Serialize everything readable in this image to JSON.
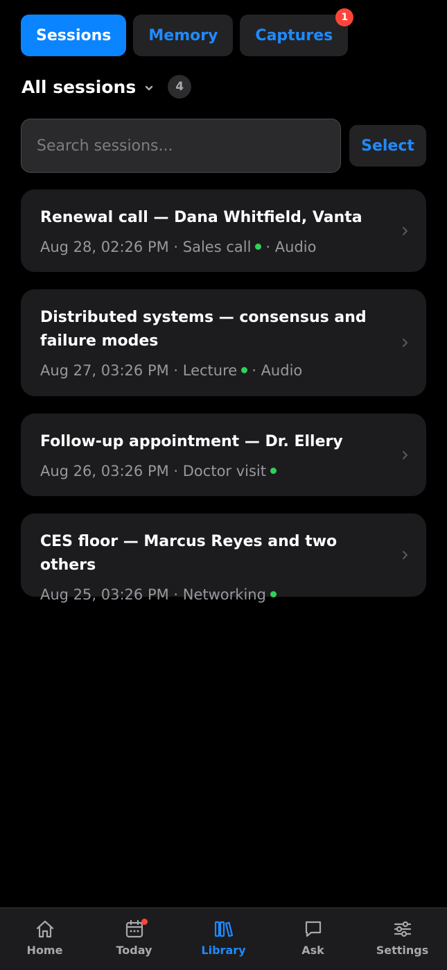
{
  "tabs": [
    {
      "label": "Sessions",
      "active": true
    },
    {
      "label": "Memory",
      "active": false
    },
    {
      "label": "Captures",
      "active": false,
      "badge": "1"
    }
  ],
  "filter": {
    "title": "All sessions",
    "count": "4"
  },
  "search": {
    "placeholder": "Search sessions..."
  },
  "select_label": "Select",
  "sessions": [
    {
      "title": "Renewal call — Dana Whitfield, Vanta",
      "date": "Aug 28, 02:26 PM",
      "type": "Sales call",
      "source": "Audio"
    },
    {
      "title": "Distributed systems — consensus and failure modes",
      "date": "Aug 27, 03:26 PM",
      "type": "Lecture",
      "source": "Audio"
    },
    {
      "title": "Follow-up appointment — Dr. Ellery",
      "date": "Aug 26, 03:26 PM",
      "type": "Doctor visit",
      "source": ""
    },
    {
      "title": "CES floor — Marcus Reyes and two others",
      "date": "Aug 25, 03:26 PM",
      "type": "Networking",
      "source": ""
    }
  ],
  "tabbar": [
    {
      "label": "Home",
      "icon": "home-icon"
    },
    {
      "label": "Today",
      "icon": "calendar-icon"
    },
    {
      "label": "Library",
      "icon": "library-icon",
      "active": true
    },
    {
      "label": "Ask",
      "icon": "chat-icon"
    },
    {
      "label": "Settings",
      "icon": "sliders-icon"
    }
  ],
  "colors": {
    "accent": "#0a84ff",
    "status": "#30d158",
    "badge": "#ff453a"
  }
}
